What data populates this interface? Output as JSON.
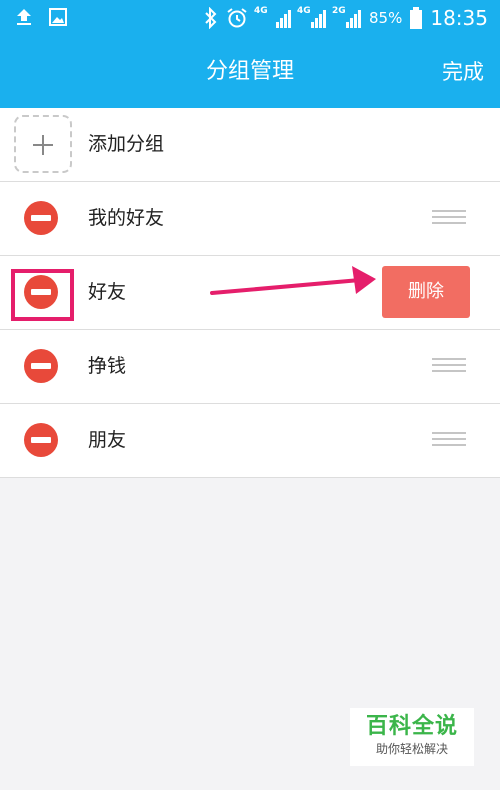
{
  "status_bar": {
    "time": "18:35",
    "battery": "85%",
    "net_left": "4G",
    "net_mid": "4G",
    "net_right": "2G",
    "icons": [
      "upload-icon",
      "image-icon",
      "bluetooth-icon",
      "alarm-icon",
      "signal-icon",
      "battery-icon"
    ]
  },
  "header": {
    "title": "分组管理",
    "done_label": "完成"
  },
  "groups": {
    "add_label": "添加分组",
    "items": [
      {
        "label": "我的好友"
      },
      {
        "label": "好友",
        "delete_label": "删除"
      },
      {
        "label": "挣钱"
      },
      {
        "label": "朋友"
      }
    ]
  },
  "annotation": {
    "color": "#e51e6b"
  },
  "watermark": {
    "title": "百科全说",
    "subtitle": "助你轻松解决"
  },
  "colors": {
    "accent": "#1ab0ee",
    "minus": "#e8493a",
    "delete": "#f26d62"
  }
}
